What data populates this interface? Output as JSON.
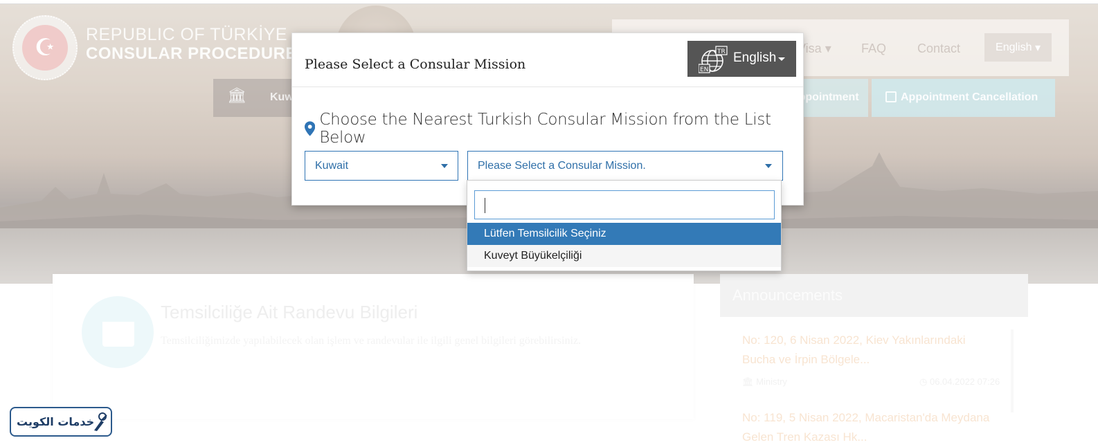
{
  "header": {
    "logo_line1": "REPUBLIC OF TÜRKİYE",
    "logo_line2": "CONSULAR PROCEDURES",
    "nav_items": [
      "Visa",
      "FAQ",
      "Contact"
    ],
    "nav_lang": "English",
    "subnav_left": "Kuwait",
    "subnav_appointment": "Appointment",
    "subnav_cancel": "Appointment Cancellation"
  },
  "info_card": {
    "title": "Temsilciliğe Ait Randevu Bilgileri",
    "description": "Temsilciliğimizde yapılabilecek olan işlem ve randevular ile ilgili genel bilgileri görebilirsiniz."
  },
  "announcements": {
    "heading": "Announcements",
    "items": [
      {
        "title": "No: 120, 6 Nisan 2022, Kiev Yakınlarındaki Bucha ve İrpin Bölgele...",
        "source": "Ministry",
        "date": "06.04.2022 07:26"
      },
      {
        "title": "No: 119, 5 Nisan 2022, Macaristan'da Meydana Gelen Tren Kazası Hk..."
      }
    ]
  },
  "modal": {
    "title": "Please Select a Consular Mission",
    "language_button": "English",
    "globe_tags": [
      "TR",
      "EN"
    ],
    "choose_text": "Choose the Nearest Turkish Consular Mission from the List Below",
    "country_select": "Kuwait",
    "mission_select": "Please Select a Consular Mission.",
    "search_value": "",
    "options": [
      "Lütfen Temsilcilik Seçiniz",
      "Kuveyt Büyükelçiliği"
    ],
    "selected_option_index": 0
  },
  "watermark": {
    "text": "خدمات الكويت"
  },
  "colors": {
    "accent_blue": "#337ab7",
    "select_border": "#2f74b5",
    "lang_button_bg": "#555555",
    "appointment_teal": "#b4e1e8"
  }
}
